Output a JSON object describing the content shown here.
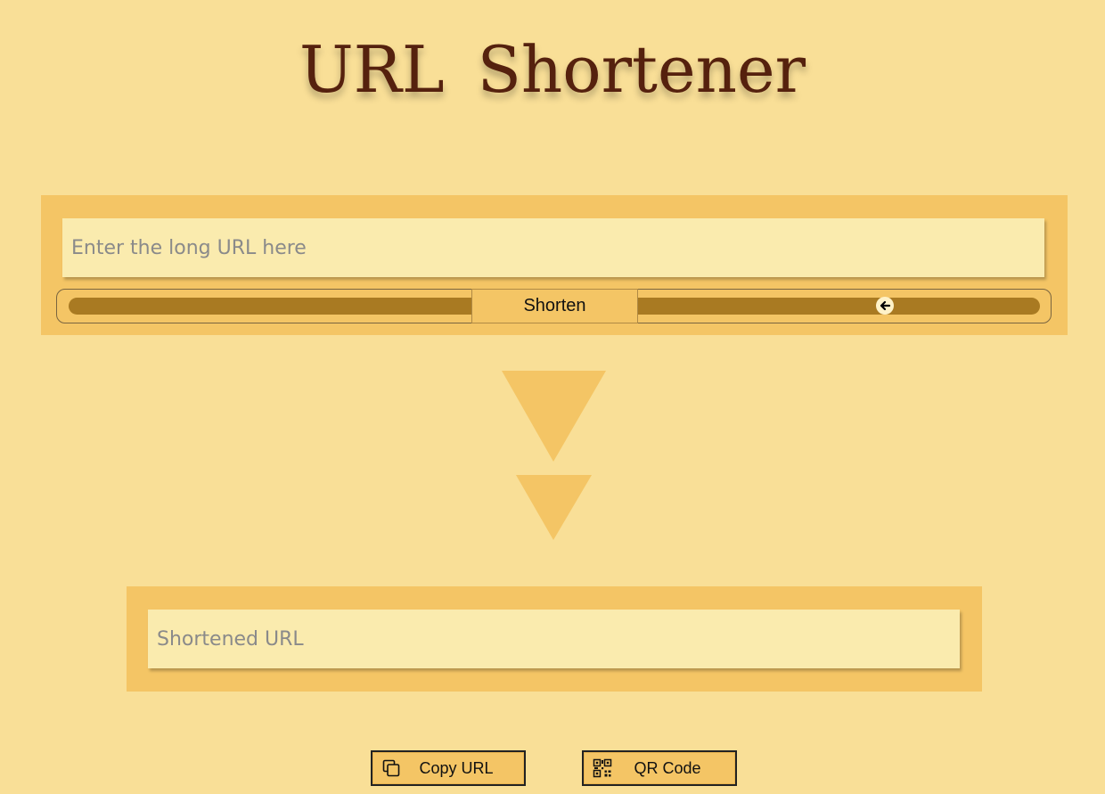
{
  "header": {
    "title": "URL  Shortener"
  },
  "input_panel": {
    "long_url_placeholder": "Enter the long URL here",
    "long_url_value": "",
    "shorten_label": "Shorten",
    "arrow_icon": "arrow-left-circle-icon"
  },
  "output_panel": {
    "short_url_placeholder": "Shortened URL",
    "short_url_value": ""
  },
  "actions": {
    "copy_label": "Copy URL",
    "copy_icon": "copy-icon",
    "qr_label": "QR Code",
    "qr_icon": "qr-code-icon"
  },
  "colors": {
    "background": "#f9df97",
    "panel": "#f4c565",
    "input": "#faebae",
    "track": "#a97a22",
    "title": "#55210e"
  }
}
